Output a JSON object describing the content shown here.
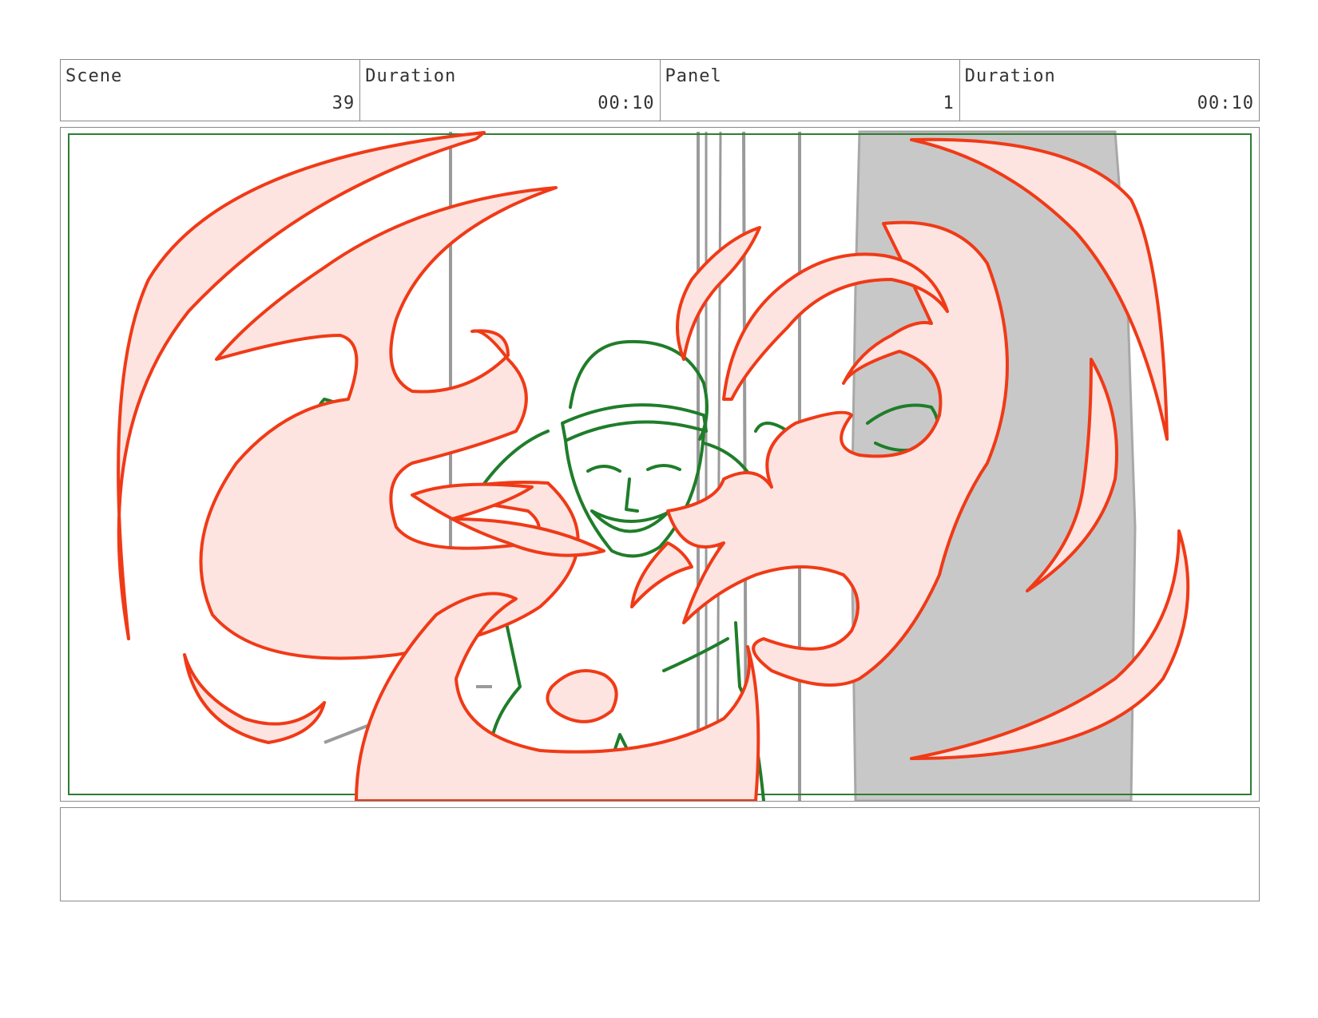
{
  "header": {
    "scene": {
      "label": "Scene",
      "value": "39"
    },
    "scene_duration": {
      "label": "Duration",
      "value": "00:10"
    },
    "panel": {
      "label": "Panel",
      "value": "1"
    },
    "panel_duration": {
      "label": "Duration",
      "value": "00:10"
    }
  },
  "notes": {
    "text": ""
  },
  "colors": {
    "flame_stroke": "#f03a17",
    "flame_fill": "#fde4e1",
    "character_stroke": "#1f7d2a",
    "safe_area": "#2e7d32",
    "background_gray": "#c8c8c8",
    "border": "#8a8a8a"
  }
}
